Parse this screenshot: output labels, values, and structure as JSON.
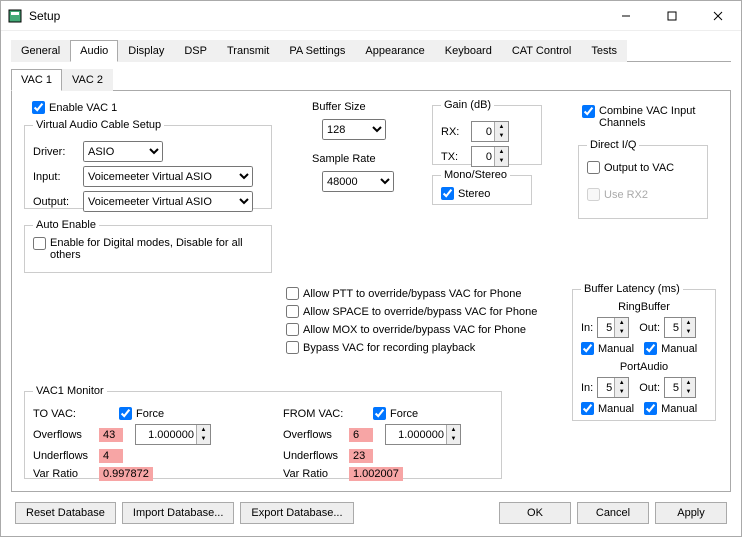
{
  "window": {
    "title": "Setup"
  },
  "tabs": [
    "General",
    "Audio",
    "Display",
    "DSP",
    "Transmit",
    "PA Settings",
    "Appearance",
    "Keyboard",
    "CAT Control",
    "Tests"
  ],
  "activeTab": 1,
  "subtabs": [
    "VAC 1",
    "VAC 2"
  ],
  "activeSubtab": 0,
  "enableVac1": "Enable VAC 1",
  "virtualCable": {
    "legend": "Virtual Audio Cable Setup",
    "driverLabel": "Driver:",
    "driverValue": "ASIO",
    "inputLabel": "Input:",
    "inputValue": "Voicemeeter Virtual ASIO",
    "outputLabel": "Output:",
    "outputValue": "Voicemeeter Virtual ASIO"
  },
  "autoEnable": {
    "legend": "Auto Enable",
    "label": "Enable for Digital modes, Disable for all others"
  },
  "bufferSize": {
    "legend": "Buffer Size",
    "value": "128"
  },
  "sampleRate": {
    "legend": "Sample Rate",
    "value": "48000"
  },
  "gain": {
    "legend": "Gain (dB)",
    "rxLabel": "RX:",
    "rxValue": "0",
    "txLabel": "TX:",
    "txValue": "0"
  },
  "monoStereo": {
    "legend": "Mono/Stereo",
    "label": "Stereo"
  },
  "combine": "Combine VAC Input Channels",
  "directIQ": {
    "legend": "Direct I/Q",
    "output": "Output to VAC",
    "useRx2": "Use RX2"
  },
  "overrides": {
    "ptt": "Allow PTT to override/bypass VAC for Phone",
    "space": "Allow SPACE to override/bypass VAC for Phone",
    "mox": "Allow MOX to override/bypass VAC for Phone",
    "bypass": "Bypass VAC for recording playback"
  },
  "bufferLatency": {
    "legend": "Buffer Latency (ms)",
    "ringLabel": "RingBuffer",
    "portLabel": "PortAudio",
    "inLabel": "In:",
    "outLabel": "Out:",
    "ringIn": "5",
    "ringOut": "5",
    "portIn": "5",
    "portOut": "5",
    "manual": "Manual"
  },
  "monitor": {
    "legend": "VAC1 Monitor",
    "toVac": "TO VAC:",
    "fromVac": "FROM VAC:",
    "force": "Force",
    "overflowsLabel": "Overflows",
    "underflowsLabel": "Underflows",
    "varRatioLabel": "Var Ratio",
    "to": {
      "overflows": "43",
      "underflows": "4",
      "varRatio": "0.997872",
      "value": "1.000000"
    },
    "from": {
      "overflows": "6",
      "underflows": "23",
      "varRatio": "1.002007",
      "value": "1.000000"
    }
  },
  "footer": {
    "reset": "Reset Database",
    "import": "Import Database...",
    "export": "Export Database...",
    "ok": "OK",
    "cancel": "Cancel",
    "apply": "Apply"
  }
}
